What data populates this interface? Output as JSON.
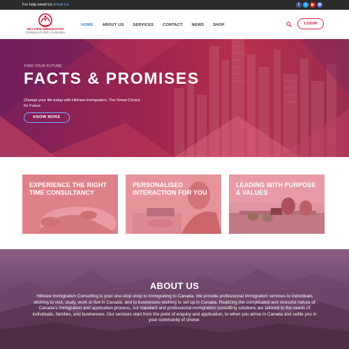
{
  "topbar": {
    "help_prefix": "For help email Us",
    "help_link": "Email Us",
    "social_icons": [
      "facebook-icon",
      "twitter-icon",
      "youtube-icon",
      "mail-icon"
    ],
    "social_colors": [
      "#3b5998",
      "#1da1f2",
      "#e02a20",
      "#4a6bd6"
    ]
  },
  "header": {
    "logo_line1": "HILLVIEW IMMIGRATION",
    "logo_line2": "CONSULTING CANADA",
    "nav": [
      "HOME",
      "ABOUT US",
      "SERVICES",
      "CONTACT",
      "NEWS",
      "SHOP"
    ],
    "active_nav": "HOME",
    "login_label": "LOGIN",
    "accent": "#2b7be4",
    "brand": "#c8102e"
  },
  "hero": {
    "kicker": "FIND YOUR FUTURE",
    "title": "FACTS & PROMISES",
    "description": "Change your life today with Hillview Immigration. The Smart Choice for Future",
    "button_label": "KNOW MORE"
  },
  "cards": [
    {
      "caption": "EXPERIENCE THE RIGHT TIME CONSULTANCY"
    },
    {
      "caption": "PERSONALISED INTERACTION FOR YOU"
    },
    {
      "caption": "LEADING WITH PURPOSE & VALUES"
    }
  ],
  "about": {
    "heading": "ABOUT US",
    "body": "Hillview Immigration Consulting is your one-stop shop to immigrating to Canada. We provide professional immigration services to individuals wishing to visit, study, work or live in Canada, and to businesses wishing to set up in Canada. Realizing the complicated and stressful nature of Canada's immigration and application process, our standard and professional immigration consulting solutions are tailored to the needs of individuals, families, and businesses. Our services start from the point of enquiry and application, to when you arrive in Canada and settle you in your community of choice."
  }
}
